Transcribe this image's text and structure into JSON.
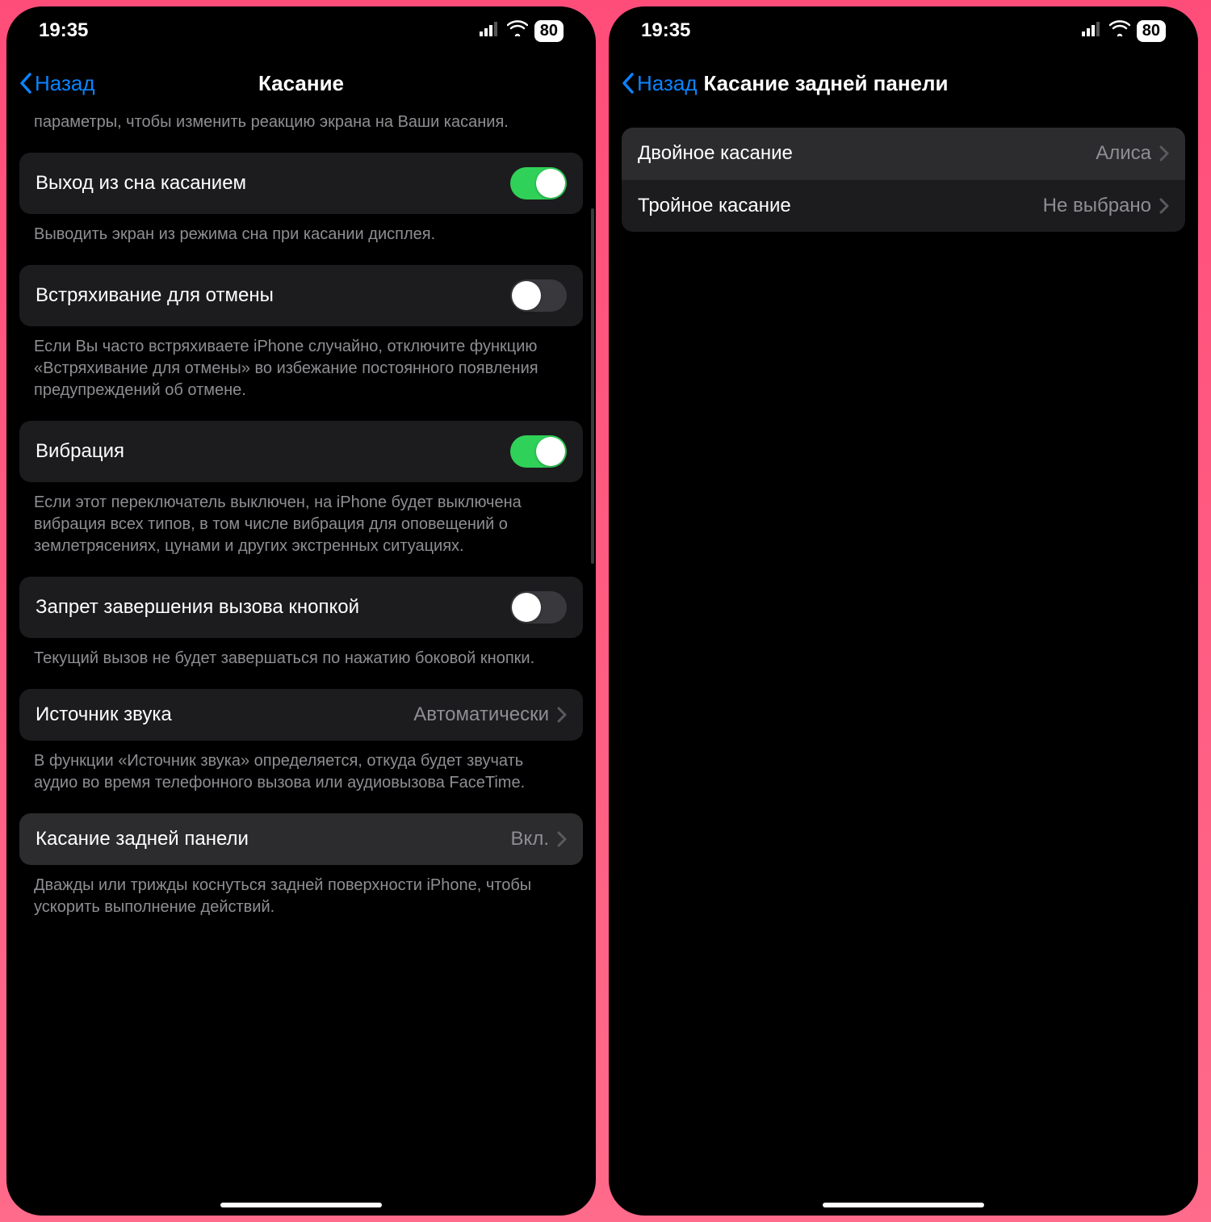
{
  "status": {
    "time": "19:35",
    "battery": "80"
  },
  "left": {
    "back": "Назад",
    "title": "Касание",
    "topNote": "параметры, чтобы изменить реакцию экрана на Ваши касания.",
    "sections": {
      "wake": {
        "label": "Выход из сна касанием",
        "note": "Выводить экран из режима сна при касании дисплея."
      },
      "shake": {
        "label": "Встряхивание для отмены",
        "note": "Если Вы часто встряхиваете iPhone случайно, отключите функцию «Встряхивание для отмены» во избежание постоянного появления предупреждений об отмене."
      },
      "vibration": {
        "label": "Вибрация",
        "note": "Если этот переключатель выключен, на iPhone будет выключена вибрация всех типов, в том числе вибрация для оповещений о землетрясениях, цунами и других экстренных ситуациях."
      },
      "endcall": {
        "label": "Запрет завершения вызова кнопкой",
        "note": "Текущий вызов не будет завершаться по нажатию боковой кнопки."
      },
      "audio": {
        "label": "Источник звука",
        "value": "Автоматически",
        "note": "В функции «Источник звука» определяется, откуда будет звучать аудио во время телефонного вызова или аудиовызова FaceTime."
      },
      "backtap": {
        "label": "Касание задней панели",
        "value": "Вкл.",
        "note": "Дважды или трижды коснуться задней поверхности iPhone, чтобы ускорить выполнение действий."
      }
    }
  },
  "right": {
    "back": "Назад",
    "title": "Касание задней панели",
    "rows": {
      "double": {
        "label": "Двойное касание",
        "value": "Алиса"
      },
      "triple": {
        "label": "Тройное касание",
        "value": "Не выбрано"
      }
    }
  }
}
